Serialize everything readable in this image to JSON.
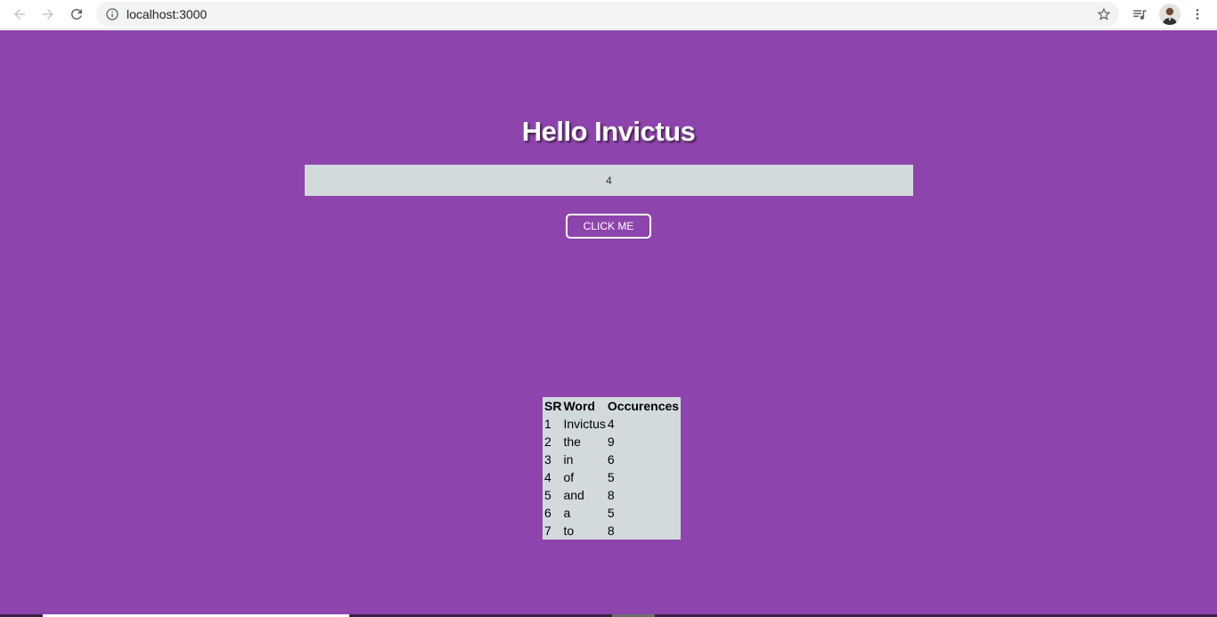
{
  "browser": {
    "url": "localhost:3000",
    "icons": {
      "back": "arrow-left-icon",
      "forward": "arrow-right-icon",
      "reload": "reload-icon",
      "info": "info-icon",
      "bookmark": "star-icon",
      "media": "media-queue-icon",
      "menu": "kebab-menu-icon"
    }
  },
  "page": {
    "background": "#8e44ad",
    "title": "Hello Invictus",
    "input_value": "4",
    "button_label": "CLICK ME"
  },
  "table": {
    "headers": [
      "SR",
      "Word",
      "Occurences"
    ],
    "rows": [
      [
        "1",
        "Invictus",
        "4"
      ],
      [
        "2",
        "the",
        "9"
      ],
      [
        "3",
        "in",
        "6"
      ],
      [
        "4",
        "of",
        "5"
      ],
      [
        "5",
        "and",
        "8"
      ],
      [
        "6",
        "a",
        "5"
      ],
      [
        "7",
        "to",
        "8"
      ]
    ]
  }
}
